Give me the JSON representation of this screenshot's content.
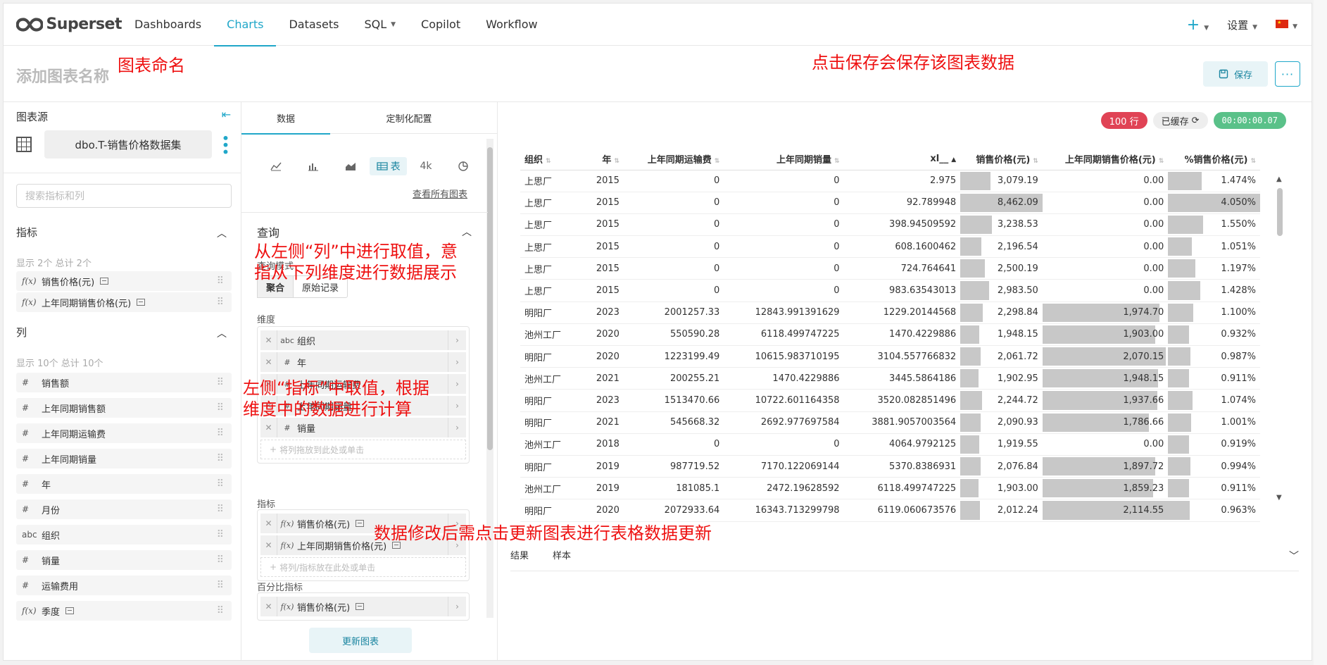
{
  "nav": {
    "brand": "Superset",
    "items": [
      "Dashboards",
      "Charts",
      "Datasets",
      "SQL",
      "Copilot",
      "Workflow"
    ],
    "settings": "设置"
  },
  "header": {
    "chart_name_placeholder": "添加图表名称",
    "save_label": "保存"
  },
  "annotations": {
    "name": "图表命名",
    "save": "点击保存会保存该图表数据",
    "columns_line1": "从左侧“列”中进行取值，意",
    "columns_line2": "指从下列维度进行数据展示",
    "metrics_line1": "左侧“指标”中取值，根据",
    "metrics_line2": "维度中的数据进行计算",
    "update": "数据修改后需点击更新图表进行表格数据更新"
  },
  "datasource": {
    "title": "图表源",
    "name": "dbo.T-销售价格数据集",
    "search_placeholder": "搜索指标和列",
    "metrics_title": "指标",
    "metrics_count": "显示 2个 总计 2个",
    "metrics": [
      {
        "type": "f(x)",
        "label": "销售价格(元)"
      },
      {
        "type": "f(x)",
        "label": "上年同期销售价格(元)"
      }
    ],
    "columns_title": "列",
    "columns_count": "显示 10个 总计 10个",
    "columns": [
      {
        "type": "#",
        "label": "销售额"
      },
      {
        "type": "#",
        "label": "上年同期销售额"
      },
      {
        "type": "#",
        "label": "上年同期运输费"
      },
      {
        "type": "#",
        "label": "上年同期销量"
      },
      {
        "type": "#",
        "label": "年"
      },
      {
        "type": "#",
        "label": "月份"
      },
      {
        "type": "abc",
        "label": "组织"
      },
      {
        "type": "#",
        "label": "销量"
      },
      {
        "type": "#",
        "label": "运输费用"
      },
      {
        "type": "f(x)",
        "label": "季度"
      }
    ]
  },
  "config": {
    "tab_data": "数据",
    "tab_custom": "定制化配置",
    "viz_table_label": "表",
    "viz_bignum_label": "4k",
    "see_all": "查看所有图表",
    "query_title": "查询",
    "query_mode_label": "查询模式",
    "mode_agg": "聚合",
    "mode_raw": "原始记录",
    "dimensions_label": "维度",
    "dimensions": [
      {
        "type": "abc",
        "label": "组织"
      },
      {
        "type": "#",
        "label": "年"
      },
      {
        "type": "#",
        "label": "上年同期运输费"
      },
      {
        "type": "#",
        "label": "上年同期销量"
      },
      {
        "type": "#",
        "label": "销量"
      }
    ],
    "dimensions_drop": "将列拖放到此处或单击",
    "metrics_label": "指标",
    "metrics": [
      {
        "type": "f(x)",
        "label": "销售价格(元)"
      },
      {
        "type": "f(x)",
        "label": "上年同期销售价格(元)"
      }
    ],
    "metrics_drop": "将列/指标放在此处或单击",
    "percent_label": "百分比指标",
    "percent_metrics": [
      {
        "type": "f(x)",
        "label": "销售价格(元)"
      }
    ],
    "update_label": "更新图表"
  },
  "results": {
    "rows_badge": "100 行",
    "cached_badge": "已缓存",
    "time_badge": "00:00:00.07",
    "columns": [
      "组织",
      "年",
      "上年同期运输费",
      "上年同期销量",
      "xl__",
      "销售价格(元)",
      "上年同期销售价格(元)",
      "%销售价格(元)"
    ],
    "rows": [
      [
        "上思厂",
        "2015",
        "0",
        "0",
        "2.975",
        "3,079.19",
        "0.00",
        "1.474%"
      ],
      [
        "上思厂",
        "2015",
        "0",
        "0",
        "92.789948",
        "8,462.09",
        "0.00",
        "4.050%"
      ],
      [
        "上思厂",
        "2015",
        "0",
        "0",
        "398.94509592",
        "3,238.53",
        "0.00",
        "1.550%"
      ],
      [
        "上思厂",
        "2015",
        "0",
        "0",
        "608.1600462",
        "2,196.54",
        "0.00",
        "1.051%"
      ],
      [
        "上思厂",
        "2015",
        "0",
        "0",
        "724.764641",
        "2,500.19",
        "0.00",
        "1.197%"
      ],
      [
        "上思厂",
        "2015",
        "0",
        "0",
        "983.63543013",
        "2,983.50",
        "0.00",
        "1.428%"
      ],
      [
        "明阳厂",
        "2023",
        "2001257.33",
        "12843.991391629",
        "1229.20144568",
        "2,298.84",
        "1,974.70",
        "1.100%"
      ],
      [
        "池州工厂",
        "2020",
        "550590.28",
        "6118.499747225",
        "1470.4229886",
        "1,948.15",
        "1,903.00",
        "0.932%"
      ],
      [
        "明阳厂",
        "2020",
        "1223199.49",
        "10615.983710195",
        "3104.557766832",
        "2,061.72",
        "2,070.15",
        "0.987%"
      ],
      [
        "池州工厂",
        "2021",
        "200255.21",
        "1470.4229886",
        "3445.5864186",
        "1,902.95",
        "1,948.15",
        "0.911%"
      ],
      [
        "明阳厂",
        "2023",
        "1513470.66",
        "10722.601164358",
        "3520.082851496",
        "2,244.72",
        "1,937.66",
        "1.074%"
      ],
      [
        "明阳厂",
        "2021",
        "545668.32",
        "2692.977697584",
        "3881.9057003564",
        "2,090.93",
        "1,786.66",
        "1.001%"
      ],
      [
        "池州工厂",
        "2018",
        "0",
        "0",
        "4064.9792125",
        "1,919.55",
        "0.00",
        "0.919%"
      ],
      [
        "明阳厂",
        "2019",
        "987719.52",
        "7170.122069144",
        "5370.8386931",
        "2,076.84",
        "1,897.72",
        "0.994%"
      ],
      [
        "池州工厂",
        "2019",
        "181085.1",
        "2472.19628592",
        "6118.499747225",
        "1,903.00",
        "1,859.23",
        "0.911%"
      ],
      [
        "明阳厂",
        "2020",
        "2072933.64",
        "16343.713299798",
        "6119.060673576",
        "2,012.24",
        "2,114.55",
        "0.963%"
      ]
    ],
    "tab_results": "结果",
    "tab_samples": "样本"
  },
  "colors": {
    "accent": "#20a7c9",
    "rows_badge": "#e04355",
    "time_badge": "#5ac189",
    "annotation": "#ee1111"
  }
}
